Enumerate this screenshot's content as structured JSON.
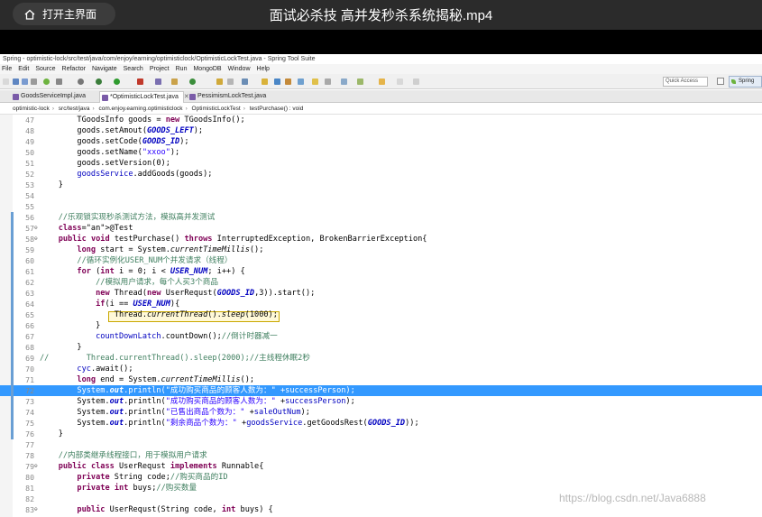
{
  "player": {
    "home_label": "打开主界面",
    "video_title": "面试必杀技 高并发秒杀系统揭秘.mp4"
  },
  "ide": {
    "window_title": "Spring - optimistic-lock/src/test/java/com/enjoy/earning/optimisticlock/OptimisticLockTest.java - Spring Tool Suite",
    "menu": [
      "File",
      "Edit",
      "Source",
      "Refactor",
      "Navigate",
      "Search",
      "Project",
      "Run",
      "MongoDB",
      "Window",
      "Help"
    ],
    "quick_access": "Quick Access",
    "perspective": "Spring",
    "tabs": [
      {
        "label": "GoodsServiceImpl.java",
        "active": false
      },
      {
        "label": "*OptimisticLockTest.java",
        "active": true
      },
      {
        "label": "PessimismLockTest.java",
        "active": false
      }
    ],
    "breadcrumb": [
      "optimistic-lock",
      "src/test/java",
      "com.enjoy.earning.optimisticlock",
      "OptimisticLockTest",
      "testPurchase() : void"
    ]
  },
  "code_lines": [
    {
      "n": "47",
      "t": "        TGoodsInfo goods = new TGoodsInfo();"
    },
    {
      "n": "48",
      "t": "        goods.setAmout(GOODS_LEFT);"
    },
    {
      "n": "49",
      "t": "        goods.setCode(GOODS_ID);"
    },
    {
      "n": "50",
      "t": "        goods.setName(\"xxoo\");"
    },
    {
      "n": "51",
      "t": "        goods.setVersion(0);"
    },
    {
      "n": "52",
      "t": "        goodsService.addGoods(goods);"
    },
    {
      "n": "53",
      "t": "    }"
    },
    {
      "n": "54",
      "t": ""
    },
    {
      "n": "55",
      "t": ""
    },
    {
      "n": "56",
      "t": "    //乐观锁实现秒杀测试方法，模拟高并发测试"
    },
    {
      "n": "57",
      "t": "    @Test"
    },
    {
      "n": "58",
      "t": "    public void testPurchase() throws InterruptedException, BrokenBarrierException{"
    },
    {
      "n": "59",
      "t": "        long start = System.currentTimeMillis();"
    },
    {
      "n": "60",
      "t": "        //循环实例化USER_NUM个并发请求（线程）"
    },
    {
      "n": "61",
      "t": "        for (int i = 0; i < USER_NUM; i++) {"
    },
    {
      "n": "62",
      "t": "            //模拟用户请求，每个人买3个商品"
    },
    {
      "n": "63",
      "t": "            new Thread(new UserRequst(GOODS_ID,3)).start();"
    },
    {
      "n": "64",
      "t": "            if(i == USER_NUM){"
    },
    {
      "n": "65",
      "t": "                Thread.currentThread().sleep(1000);"
    },
    {
      "n": "66",
      "t": "            }"
    },
    {
      "n": "67",
      "t": "            countDownLatch.countDown();//倒计时器减一"
    },
    {
      "n": "68",
      "t": "        }"
    },
    {
      "n": "69",
      "t": "//        Thread.currentThread().sleep(2000);//主线程休眠2秒"
    },
    {
      "n": "70",
      "t": "        cyc.await();"
    },
    {
      "n": "71",
      "t": "        long end = System.currentTimeMillis();"
    },
    {
      "n": "72",
      "t": "        System.out.println(\"成功购买商品的顾客人数为：\" +successPerson);"
    },
    {
      "n": "73",
      "t": "        System.out.println(\"成功购买商品的顾客人数为：\" +successPerson);"
    },
    {
      "n": "74",
      "t": "        System.out.println(\"已售出商品个数为：\" +saleOutNum);"
    },
    {
      "n": "75",
      "t": "        System.out.println(\"剩余商品个数为：\" +goodsService.getGoodsRest(GOODS_ID));"
    },
    {
      "n": "76",
      "t": "    }"
    },
    {
      "n": "77",
      "t": ""
    },
    {
      "n": "78",
      "t": "    //内部类继承线程接口，用于模拟用户请求"
    },
    {
      "n": "79",
      "t": "    public class UserRequst implements Runnable{"
    },
    {
      "n": "80",
      "t": "        private String code;//购买商品的ID"
    },
    {
      "n": "81",
      "t": "        private int buys;//购买数量"
    },
    {
      "n": "82",
      "t": ""
    },
    {
      "n": "83",
      "t": "        public UserRequst(String code, int buys) {"
    }
  ],
  "watermark": "https://blog.csdn.net/Java6888"
}
